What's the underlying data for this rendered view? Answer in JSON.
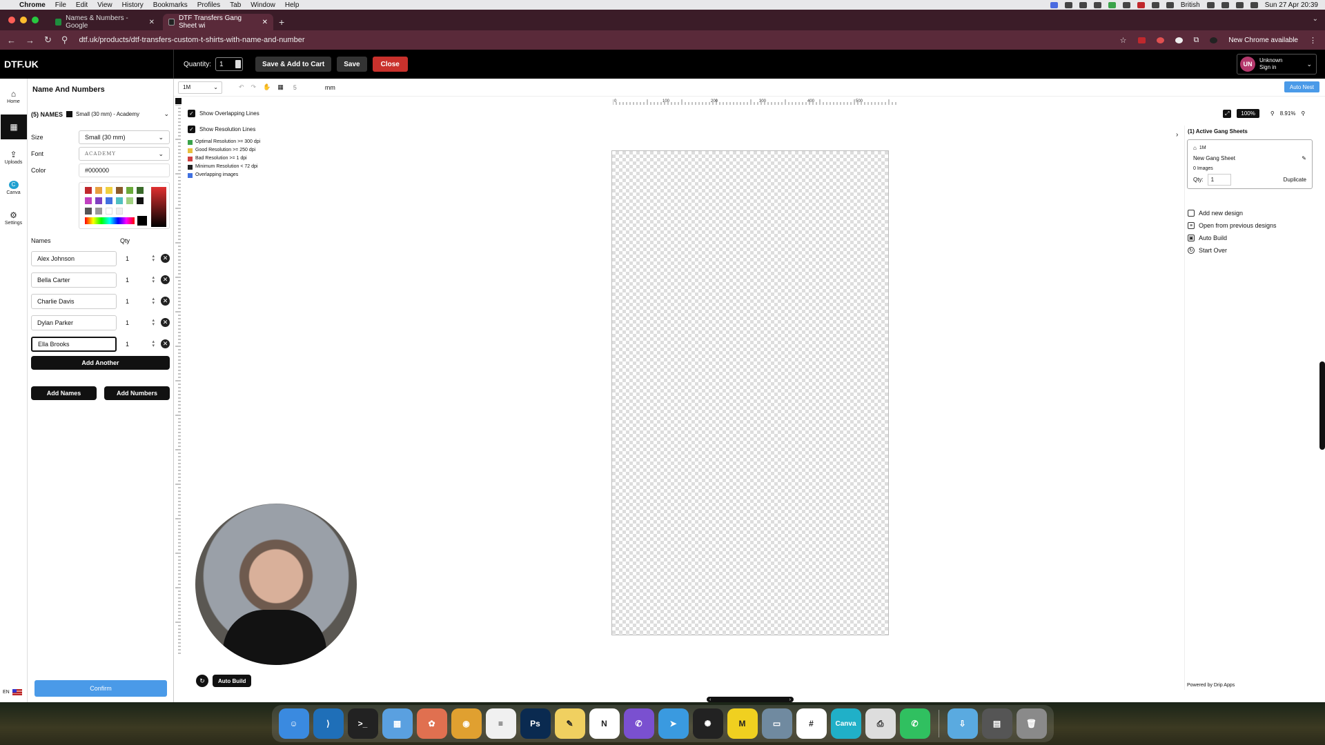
{
  "menubar": {
    "app": "Chrome",
    "items": [
      "File",
      "Edit",
      "View",
      "History",
      "Bookmarks",
      "Profiles",
      "Tab",
      "Window",
      "Help"
    ],
    "lang": "British",
    "clock": "Sun 27 Apr 20:39"
  },
  "browser": {
    "tabs": [
      {
        "label": "Names & Numbers - Google",
        "color": "#1e8e3e"
      },
      {
        "label": "DTF Transfers Gang Sheet wi",
        "color": "#222222"
      }
    ],
    "url": "dtf.uk/products/dtf-transfers-custom-t-shirts-with-name-and-number",
    "new_chrome": "New Chrome available"
  },
  "appbar": {
    "brand": "DTF.UK",
    "quantity_label": "Quantity:",
    "quantity_value": "1",
    "save_add_cart": "Save & Add to Cart",
    "save": "Save",
    "close": "Close",
    "user_initials": "UN",
    "user_name": "Unknown",
    "user_sub": "Sign in"
  },
  "rail": {
    "items": [
      {
        "label": "Home",
        "icon": "⌂"
      },
      {
        "label": "",
        "icon": "▦"
      },
      {
        "label": "Uploads",
        "icon": "⇪"
      },
      {
        "label": "Canva",
        "icon": "C"
      },
      {
        "label": "Settings",
        "icon": "⚙"
      }
    ],
    "lang": "EN"
  },
  "panel": {
    "title": "Name And Numbers",
    "group_label": "(5) NAMES",
    "group_sub": "Small (30 mm) - Academy",
    "size_label": "Size",
    "size_value": "Small (30 mm)",
    "font_label": "Font",
    "font_value": "ACADEMY",
    "color_label": "Color",
    "color_value": "#000000",
    "names_header": "Names",
    "qty_header": "Qty",
    "rows": [
      {
        "name": "Alex  Johnson",
        "qty": "1"
      },
      {
        "name": "Bella   Carter",
        "qty": "1"
      },
      {
        "name": "Charlie Davis",
        "qty": "1"
      },
      {
        "name": "Dylan   Parker",
        "qty": "1"
      },
      {
        "name": "Ella  Brooks",
        "qty": "1"
      }
    ],
    "add_another": "Add Another",
    "add_names": "Add Names",
    "add_numbers": "Add Numbers",
    "confirm": "Confirm",
    "swatches": [
      "#c0282d",
      "#e8a040",
      "#f0d040",
      "#8a5a2a",
      "#6aaa3a",
      "#3a6a2a",
      "#c040c0",
      "#8040c0",
      "#4070e0",
      "#50c0c0",
      "#a0d080",
      "#111111",
      "#555555",
      "#999999",
      "#ffffff",
      "#eeeeee"
    ]
  },
  "toolbar": {
    "size_select": "1M",
    "spacing_value": "5",
    "unit": "mm",
    "auto_nest": "Auto Nest"
  },
  "canvas_opts": {
    "show_overlap": "Show Overlapping Lines",
    "show_resolution": "Show Resolution Lines",
    "legend": [
      {
        "label": "Optimal Resolution >= 300 dpi",
        "color": "#3aa34a"
      },
      {
        "label": "Good Resolution >= 250 dpi",
        "color": "#e8c040"
      },
      {
        "label": "Bad Resolution >= 1 dpi",
        "color": "#d04040"
      },
      {
        "label": "Minimum Resolution < 72 dpi",
        "color": "#222222"
      },
      {
        "label": "Overlapping images",
        "color": "#4070e0"
      }
    ]
  },
  "ruler": {
    "ticks": [
      "0",
      "100",
      "200",
      "300",
      "400",
      "500",
      "570 mm"
    ]
  },
  "zoom": {
    "level": "100%",
    "percent": "8.91%"
  },
  "right_panel": {
    "title": "(1)  Active Gang Sheets",
    "card_size": "1M",
    "card_name": "New Gang Sheet",
    "card_images": "0 Images",
    "card_qty_label": "Qty:",
    "card_qty": "1",
    "duplicate": "Duplicate",
    "actions": [
      "Add new design",
      "Open from previous designs",
      "Auto Build",
      "Start Over"
    ],
    "powered": "Powered by Drip Apps"
  },
  "bottom": {
    "auto_build": "Auto Build"
  },
  "dock": [
    {
      "name": "finder",
      "color": "#3a8ae0",
      "glyph": "☺"
    },
    {
      "name": "vscode",
      "color": "#1f6fb8",
      "glyph": "⟩"
    },
    {
      "name": "terminal",
      "color": "#222222",
      "glyph": ">_"
    },
    {
      "name": "screens",
      "color": "#5aa0e0",
      "glyph": "▦"
    },
    {
      "name": "photos",
      "color": "#e07050",
      "glyph": "✿"
    },
    {
      "name": "chrome",
      "color": "#e0a030",
      "glyph": "◉"
    },
    {
      "name": "reminders",
      "color": "#f0f0f0",
      "glyph": "≡"
    },
    {
      "name": "photoshop",
      "color": "#0a2a50",
      "glyph": "Ps"
    },
    {
      "name": "notes",
      "color": "#f0d060",
      "glyph": "✎"
    },
    {
      "name": "notion",
      "color": "#ffffff",
      "glyph": "N"
    },
    {
      "name": "viber",
      "color": "#7a50d0",
      "glyph": "✆"
    },
    {
      "name": "telegram",
      "color": "#3a9ae0",
      "glyph": "➤"
    },
    {
      "name": "chatgpt",
      "color": "#222222",
      "glyph": "✺"
    },
    {
      "name": "miro",
      "color": "#f0d020",
      "glyph": "M"
    },
    {
      "name": "preview",
      "color": "#708aa0",
      "glyph": "▭"
    },
    {
      "name": "slack",
      "color": "#ffffff",
      "glyph": "#"
    },
    {
      "name": "canva",
      "color": "#20b0c8",
      "glyph": "Canva"
    },
    {
      "name": "printer",
      "color": "#dddddd",
      "glyph": "⎙"
    },
    {
      "name": "whatsapp",
      "color": "#30c060",
      "glyph": "✆"
    },
    {
      "name": "downloads",
      "color": "#5aaae0",
      "glyph": "⇩"
    },
    {
      "name": "stack",
      "color": "#555555",
      "glyph": "▤"
    },
    {
      "name": "trash",
      "color": "#8a8a8a",
      "glyph": "🗑"
    }
  ]
}
